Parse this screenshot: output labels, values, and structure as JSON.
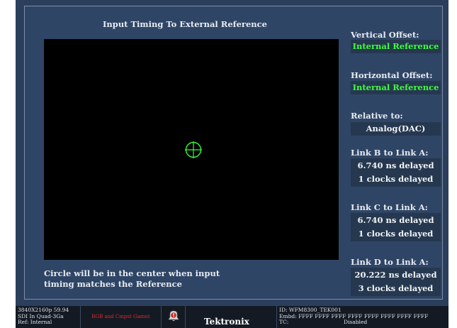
{
  "plot": {
    "title": "Input Timing To External Reference",
    "footnote_line1": "Circle will be in the center when input",
    "footnote_line2": "timing matches the Reference"
  },
  "side": {
    "vertical_offset_label": "Vertical Offset:",
    "vertical_offset_value": "Internal Reference",
    "horizontal_offset_label": "Horizontal Offset:",
    "horizontal_offset_value": "Internal Reference",
    "relative_to_label": "Relative to:",
    "relative_to_value": "Analog(DAC)",
    "link_b_label": "Link B to Link A:",
    "link_b_ns": "6.740 ns delayed",
    "link_b_clocks": "1 clocks delayed",
    "link_c_label": "Link C to Link A:",
    "link_c_ns": "6.740 ns delayed",
    "link_c_clocks": "1 clocks delayed",
    "link_d_label": "Link D to Link A:",
    "link_d_ns": "20.222 ns delayed",
    "link_d_clocks": "3 clocks delayed"
  },
  "status": {
    "format": "3840X2160p 59.94",
    "input": "SDI In Quad-3Ga",
    "ref": "Ref: Internal",
    "gamut": "RGB and Cmpst Gamut",
    "alarm_icon": "alarm-bell-icon",
    "brand": "Tektronix",
    "id": "ID: WFM8300_TEK001",
    "embd": "Embd: FFFF FFFF FFFF FFFF FFFF FFFF FFFF FFFF",
    "tc_label": "TC:",
    "tc_value": "Disabled"
  },
  "colors": {
    "background": "#2b3f5c",
    "plot_background": "#000000",
    "crosshair": "#33ff33",
    "reference_value": "#3dff3d",
    "gamut_alarm": "#e02a2a"
  }
}
